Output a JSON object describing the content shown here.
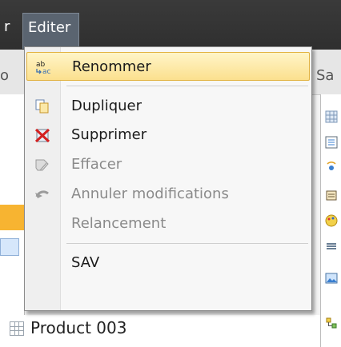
{
  "menubar": {
    "left_fragment": "r",
    "editer_label": "Editer"
  },
  "background": {
    "left_fragment": "o",
    "right_fragment": "Sa",
    "product_label": "Product 003"
  },
  "menu": {
    "items": [
      {
        "label": "Renommer",
        "icon": "rename-icon",
        "highlighted": true,
        "disabled": false
      },
      {
        "label": "Dupliquer",
        "icon": "duplicate-icon",
        "highlighted": false,
        "disabled": false
      },
      {
        "label": "Supprimer",
        "icon": "delete-icon",
        "highlighted": false,
        "disabled": false
      },
      {
        "label": "Effacer",
        "icon": "erase-icon",
        "highlighted": false,
        "disabled": true
      },
      {
        "label": "Annuler modifications",
        "icon": "undo-icon",
        "highlighted": false,
        "disabled": true
      },
      {
        "label": "Relancement",
        "icon": "",
        "highlighted": false,
        "disabled": true
      },
      {
        "label": "SAV",
        "icon": "",
        "highlighted": false,
        "disabled": false
      }
    ]
  },
  "colors": {
    "menubar": "#333333",
    "highlight": "#fbe08e",
    "highlight_border": "#e2b23f",
    "disabled_text": "#8a8a8a"
  }
}
